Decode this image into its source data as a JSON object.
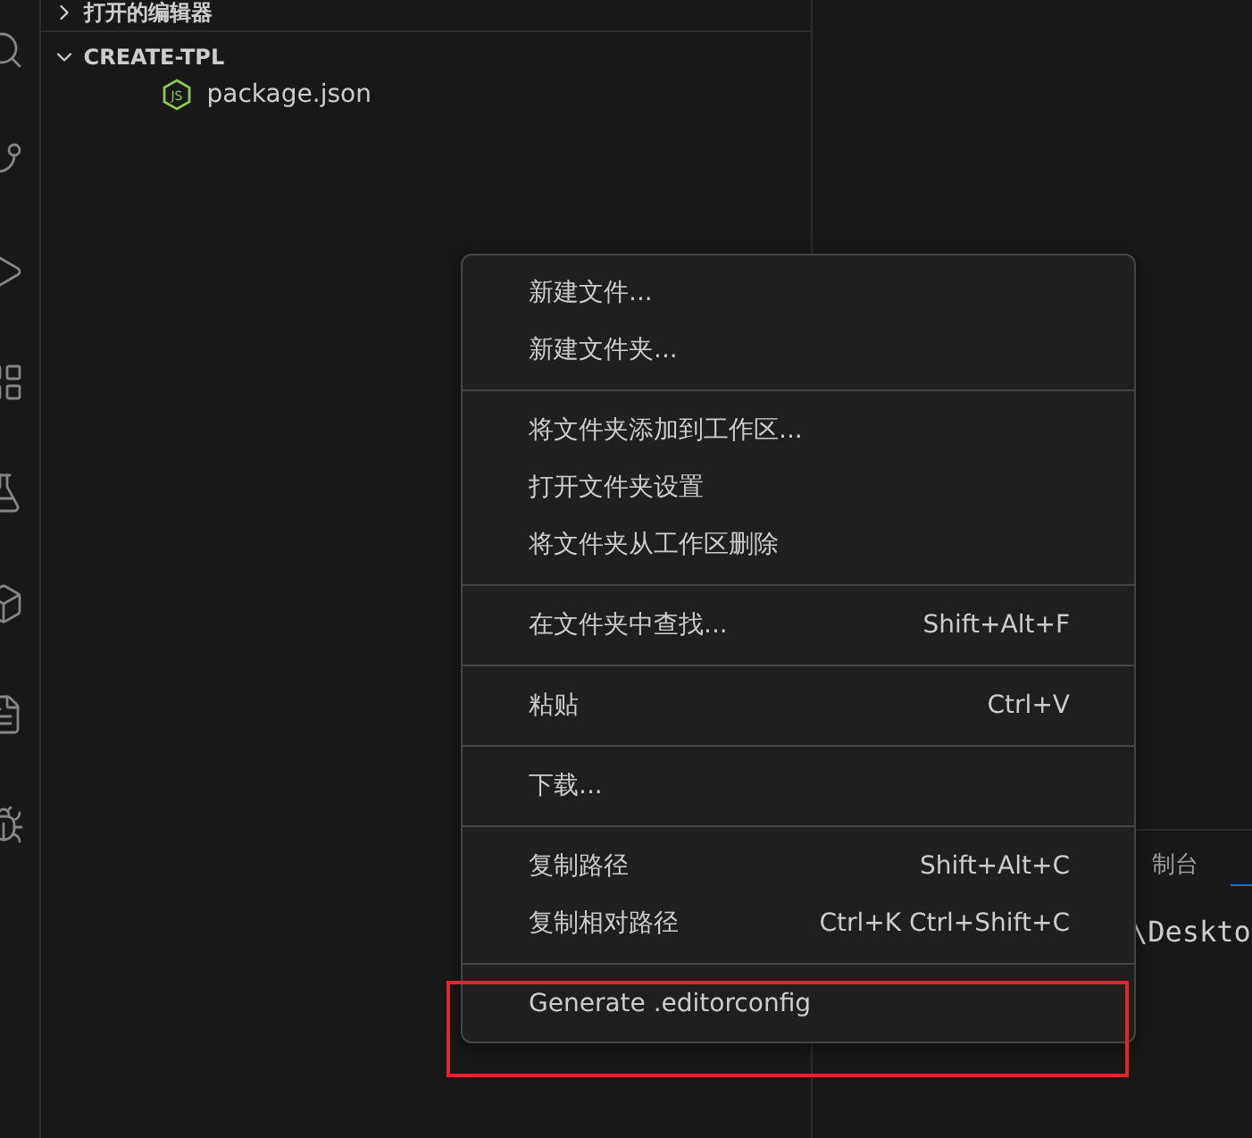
{
  "explorer": {
    "sections": [
      {
        "title": "打开的编辑器",
        "expanded": false
      },
      {
        "title": "CREATE-TPL",
        "expanded": true
      }
    ],
    "files": [
      {
        "name": "package.json",
        "icon_text": "JS"
      }
    ]
  },
  "panel": {
    "tabs": [
      {
        "label": "制台",
        "selected": false
      },
      {
        "selected": true
      }
    ],
    "terminal_text": "\\Deskto"
  },
  "context_menu": {
    "groups": [
      {
        "items": [
          {
            "label": "新建文件..."
          },
          {
            "label": "新建文件夹..."
          }
        ]
      },
      {
        "items": [
          {
            "label": "将文件夹添加到工作区..."
          },
          {
            "label": "打开文件夹设置"
          },
          {
            "label": "将文件夹从工作区删除"
          }
        ]
      },
      {
        "items": [
          {
            "label": "在文件夹中查找...",
            "shortcut": "Shift+Alt+F"
          }
        ]
      },
      {
        "items": [
          {
            "label": "粘贴",
            "shortcut": "Ctrl+V"
          }
        ]
      },
      {
        "items": [
          {
            "label": "下载..."
          }
        ]
      },
      {
        "items": [
          {
            "label": "复制路径",
            "shortcut": "Shift+Alt+C"
          },
          {
            "label": "复制相对路径",
            "shortcut": "Ctrl+K Ctrl+Shift+C"
          }
        ]
      },
      {
        "items": [
          {
            "label": "Generate .editorconfig",
            "highlighted": true
          }
        ]
      }
    ]
  }
}
